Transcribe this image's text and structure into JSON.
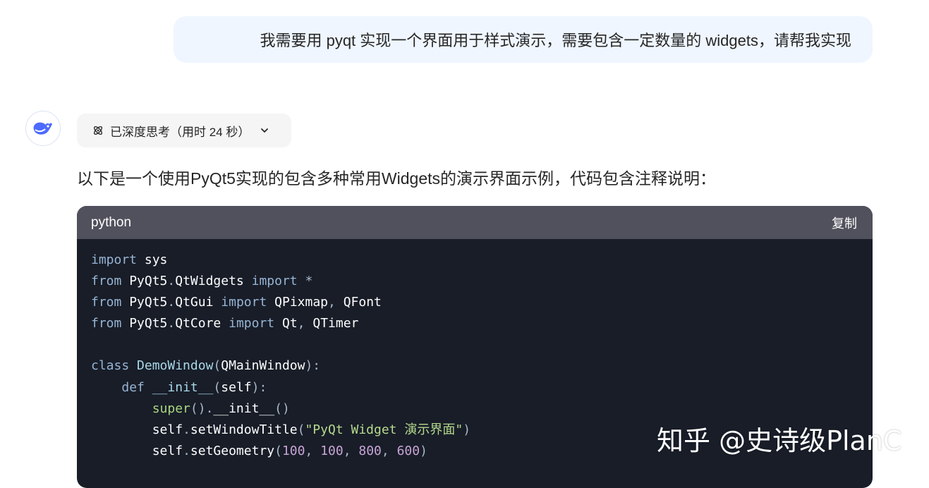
{
  "user_message": "我需要用 pyqt 实现一个界面用于样式演示，需要包含一定数量的 widgets，请帮我实现",
  "thinking_chip": {
    "label": "已深度思考（用时 24 秒）",
    "icon": "atom-icon",
    "chevron": "chevron-down-icon"
  },
  "assistant_avatar_icon": "whale-logo-icon",
  "intro_text": "以下是一个使用PyQt5实现的包含多种常用Widgets的演示界面示例，代码包含注释说明：",
  "code_block": {
    "language": "python",
    "copy_label": "复制",
    "lines": [
      [
        [
          "kw",
          "import"
        ],
        [
          "pl",
          " "
        ],
        [
          "nm",
          "sys"
        ]
      ],
      [
        [
          "kw",
          "from"
        ],
        [
          "pl",
          " "
        ],
        [
          "nm",
          "PyQt5"
        ],
        [
          "pn",
          "."
        ],
        [
          "nm",
          "QtWidgets"
        ],
        [
          "pl",
          " "
        ],
        [
          "kw",
          "import"
        ],
        [
          "pl",
          " "
        ],
        [
          "pn",
          "*"
        ]
      ],
      [
        [
          "kw",
          "from"
        ],
        [
          "pl",
          " "
        ],
        [
          "nm",
          "PyQt5"
        ],
        [
          "pn",
          "."
        ],
        [
          "nm",
          "QtGui"
        ],
        [
          "pl",
          " "
        ],
        [
          "kw",
          "import"
        ],
        [
          "pl",
          " "
        ],
        [
          "nm",
          "QPixmap"
        ],
        [
          "pn",
          ","
        ],
        [
          "pl",
          " "
        ],
        [
          "nm",
          "QFont"
        ]
      ],
      [
        [
          "kw",
          "from"
        ],
        [
          "pl",
          " "
        ],
        [
          "nm",
          "PyQt5"
        ],
        [
          "pn",
          "."
        ],
        [
          "nm",
          "QtCore"
        ],
        [
          "pl",
          " "
        ],
        [
          "kw",
          "import"
        ],
        [
          "pl",
          " "
        ],
        [
          "nm",
          "Qt"
        ],
        [
          "pn",
          ","
        ],
        [
          "pl",
          " "
        ],
        [
          "nm",
          "QTimer"
        ]
      ],
      [],
      [
        [
          "kw",
          "class"
        ],
        [
          "pl",
          " "
        ],
        [
          "cls",
          "DemoWindow"
        ],
        [
          "pn",
          "("
        ],
        [
          "nm",
          "QMainWindow"
        ],
        [
          "pn",
          "):"
        ]
      ],
      [
        [
          "pl",
          "    "
        ],
        [
          "kw",
          "def"
        ],
        [
          "pl",
          " "
        ],
        [
          "cls",
          "__init__"
        ],
        [
          "pn",
          "("
        ],
        [
          "nm",
          "self"
        ],
        [
          "pn",
          "):"
        ]
      ],
      [
        [
          "pl",
          "        "
        ],
        [
          "bi",
          "super"
        ],
        [
          "pn",
          "()."
        ],
        [
          "nm",
          "__init__"
        ],
        [
          "pn",
          "()"
        ]
      ],
      [
        [
          "pl",
          "        "
        ],
        [
          "nm",
          "self"
        ],
        [
          "pn",
          "."
        ],
        [
          "nm",
          "setWindowTitle"
        ],
        [
          "pn",
          "("
        ],
        [
          "st",
          "\"PyQt Widget 演示界面\""
        ],
        [
          "pn",
          ")"
        ]
      ],
      [
        [
          "pl",
          "        "
        ],
        [
          "nm",
          "self"
        ],
        [
          "pn",
          "."
        ],
        [
          "nm",
          "setGeometry"
        ],
        [
          "pn",
          "("
        ],
        [
          "nu",
          "100"
        ],
        [
          "pn",
          ", "
        ],
        [
          "nu",
          "100"
        ],
        [
          "pn",
          ", "
        ],
        [
          "nu",
          "800"
        ],
        [
          "pn",
          ", "
        ],
        [
          "nu",
          "600"
        ],
        [
          "pn",
          ")"
        ]
      ]
    ]
  },
  "watermark": "知乎 @史诗级PlanC"
}
